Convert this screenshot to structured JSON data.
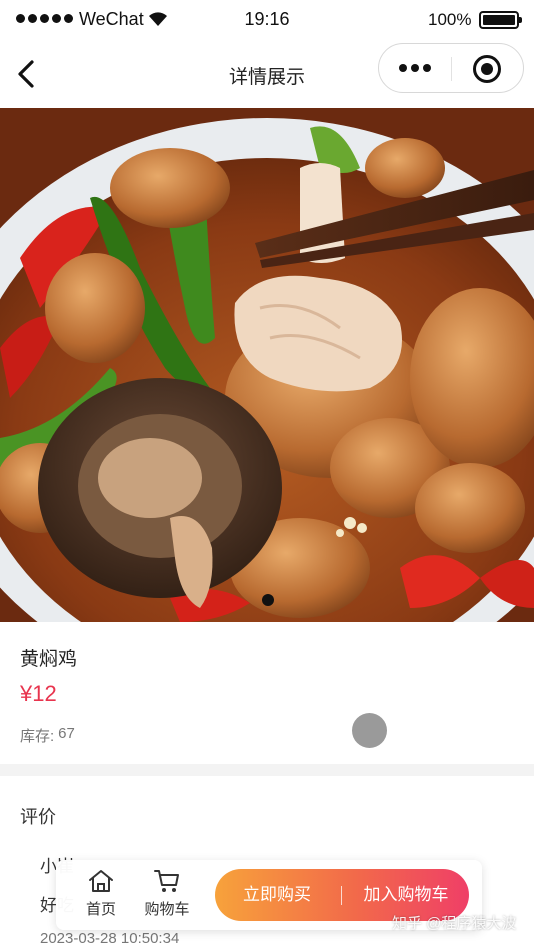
{
  "status_bar": {
    "carrier": "WeChat",
    "time": "19:16",
    "battery": "100%"
  },
  "nav": {
    "title": "详情展示"
  },
  "product": {
    "name": "黄焖鸡",
    "price": "¥12",
    "stock_label": "库存:",
    "stock_value": "67"
  },
  "review": {
    "title": "评价",
    "user": "小崔",
    "content": "好吃",
    "time": "2023-03-28 10:50:34"
  },
  "bottom_bar": {
    "home_label": "首页",
    "cart_label": "购物车",
    "buy_now": "立即购买",
    "add_to_cart": "加入购物车"
  },
  "watermark": "知乎 @程序猿大波",
  "colors": {
    "price": "#e8344e",
    "cta_start": "#f7a23b",
    "cta_end": "#ef3f67"
  }
}
